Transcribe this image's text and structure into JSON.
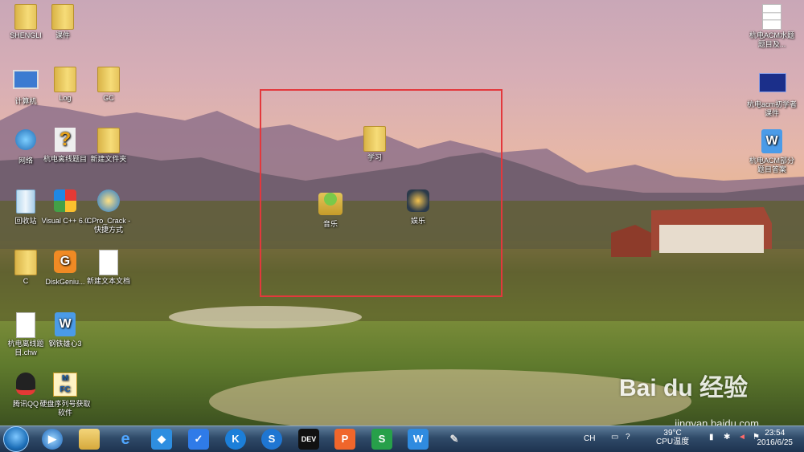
{
  "desktop_icons": [
    {
      "label": "SHENGLI",
      "kind": "user"
    },
    {
      "label": "课件",
      "kind": "folder"
    },
    {
      "label": "计算机",
      "kind": "computer"
    },
    {
      "label": "Log",
      "kind": "folder"
    },
    {
      "label": "GC",
      "kind": "folder"
    },
    {
      "label": "网络",
      "kind": "network"
    },
    {
      "label": "杭电离线题目",
      "kind": "help"
    },
    {
      "label": "新建文件夹",
      "kind": "folder"
    },
    {
      "label": "回收站",
      "kind": "recycle"
    },
    {
      "label": "Visual C++ 6.0",
      "kind": "vc"
    },
    {
      "label": "CPro_Crack - 快捷方式",
      "kind": "app"
    },
    {
      "label": "C",
      "kind": "folder"
    },
    {
      "label": "DiskGeniu...",
      "kind": "disk"
    },
    {
      "label": "新建文本文档",
      "kind": "doc"
    },
    {
      "label": "杭电离线题目.chw",
      "kind": "doc"
    },
    {
      "label": "钢铁雄心3",
      "kind": "wps"
    },
    {
      "label": "腾讯QQ",
      "kind": "qq"
    },
    {
      "label": "硬盘序列号获取软件",
      "kind": "app2"
    },
    {
      "label": "学习",
      "kind": "folder"
    },
    {
      "label": "音乐",
      "kind": "music"
    },
    {
      "label": "娱乐",
      "kind": "game"
    },
    {
      "label": "杭电ACM水题题目及...",
      "kind": "sheet"
    },
    {
      "label": "杭电acm初学者课件",
      "kind": "ppt"
    },
    {
      "label": "杭电ACM部分题目答案",
      "kind": "wps"
    }
  ],
  "watermark": {
    "brand": "Bai du 经验",
    "url": "jingyan.baidu.com"
  },
  "taskbar": {
    "pinned": [
      "windows-media-player-icon",
      "explorer-icon",
      "ie-icon",
      "app-icon",
      "shield-icon",
      "k-icon",
      "s-icon",
      "dev-icon",
      "presentation-icon",
      "sheet-icon",
      "word-icon",
      "settings-icon"
    ],
    "tray": {
      "ime": "CH",
      "temp": "39°C",
      "temp_label": "CPU温度",
      "time": "23:54",
      "date": "2016/6/25"
    }
  },
  "colors": {
    "selection": "#e3383c"
  }
}
